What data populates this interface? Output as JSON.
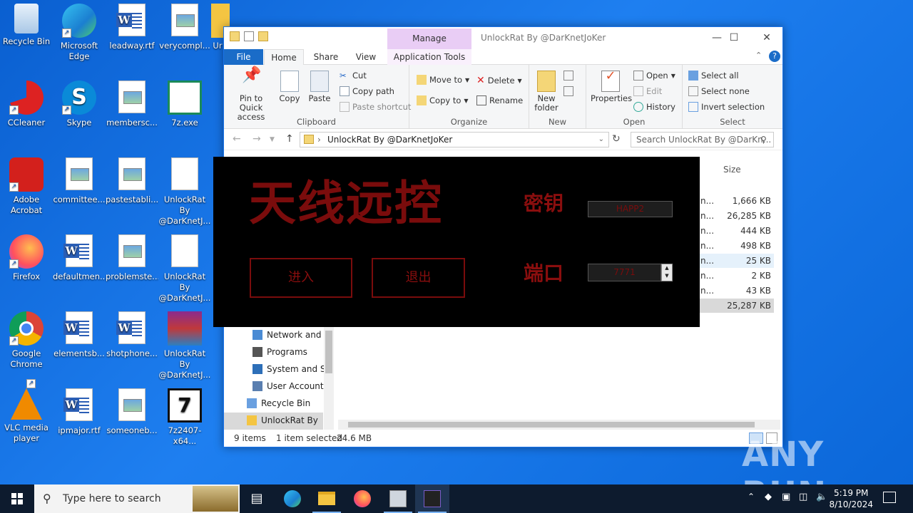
{
  "desktop": {
    "icons": [
      {
        "label": "Recycle Bin"
      },
      {
        "label": "Microsoft Edge"
      },
      {
        "label": "leadway.rtf"
      },
      {
        "label": "verycompl..."
      },
      {
        "label": "Ur"
      },
      {
        "label": "CCleaner"
      },
      {
        "label": "Skype"
      },
      {
        "label": "membersc..."
      },
      {
        "label": "7z.exe"
      },
      {
        "label": "Adobe Acrobat"
      },
      {
        "label": "committee..."
      },
      {
        "label": "pastestabli..."
      },
      {
        "label": "UnlockRat By @DarKnetJ..."
      },
      {
        "label": "Firefox"
      },
      {
        "label": "defaultmen..."
      },
      {
        "label": "problemste..."
      },
      {
        "label": "UnlockRat By @DarKnetJ..."
      },
      {
        "label": "Google Chrome"
      },
      {
        "label": "elementsb..."
      },
      {
        "label": "shotphone..."
      },
      {
        "label": "UnlockRat By @DarKnetJ..."
      },
      {
        "label": "VLC media player"
      },
      {
        "label": "ipmajor.rtf"
      },
      {
        "label": "someoneb..."
      },
      {
        "label": "7z2407-x64..."
      }
    ]
  },
  "explorer": {
    "title": "UnlockRat By @DarKnetJoKer",
    "manage_tab": "Manage",
    "tabs": {
      "file": "File",
      "home": "Home",
      "share": "Share",
      "view": "View",
      "app_tools": "Application Tools"
    },
    "clipboard": {
      "pin": "Pin to Quick access",
      "copy": "Copy",
      "paste": "Paste",
      "cut": "Cut",
      "copy_path": "Copy path",
      "paste_shortcut": "Paste shortcut",
      "group": "Clipboard"
    },
    "organize": {
      "move_to": "Move to",
      "copy_to": "Copy to",
      "delete": "Delete",
      "rename": "Rename",
      "group": "Organize"
    },
    "new": {
      "new_folder": "New folder",
      "group": "New"
    },
    "open": {
      "properties": "Properties",
      "open": "Open",
      "edit": "Edit",
      "history": "History",
      "group": "Open"
    },
    "select": {
      "select_all": "Select all",
      "select_none": "Select none",
      "invert": "Invert selection",
      "group": "Select"
    },
    "address": "UnlockRat By @DarKnetJoKer",
    "search_placeholder": "Search UnlockRat By @DarKn...",
    "col_size": "Size",
    "sizes": [
      "1,666 KB",
      "26,285 KB",
      "444 KB",
      "498 KB",
      "25 KB",
      "2 KB",
      "43 KB",
      "25,287 KB"
    ],
    "nav": [
      "Network and Ir",
      "Programs",
      "System and Sec",
      "User Accounts",
      "Recycle Bin",
      "UnlockRat By @I"
    ],
    "status": {
      "items": "9 items",
      "selected": "1 item selected",
      "size": "24.6 MB"
    }
  },
  "rat": {
    "brand": "天线远控",
    "key_label": "密钥",
    "key_value": "HAPP2",
    "port_label": "端口",
    "port_value": "7771",
    "enter": "进入",
    "exit": "退出"
  },
  "taskbar": {
    "search_placeholder": "Type here to search",
    "time": "5:19 PM",
    "date": "8/10/2024"
  },
  "watermark": "ANY RUN"
}
